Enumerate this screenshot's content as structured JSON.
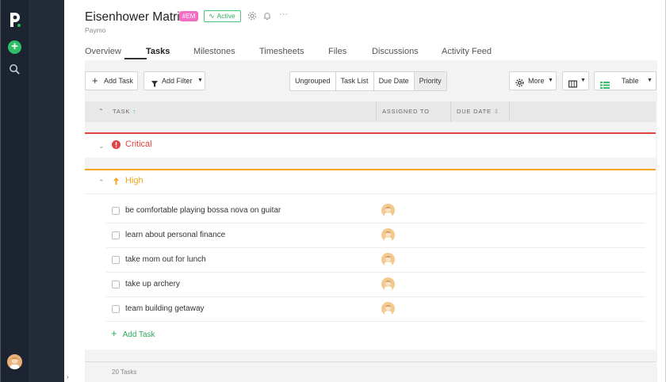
{
  "sidebar": {
    "logo": "p-logo",
    "add_icon": "plus-icon",
    "search_icon": "search-icon",
    "nav_icons": [
      "home-icon",
      "projects-icon",
      "folder-icon",
      "user-icon",
      "money-icon",
      "ledger-icon",
      "table-icon",
      "refresh-icon",
      "calendar-icon",
      "clock-icon",
      "pie-chart-icon",
      "report-icon"
    ],
    "help_icon": "info-icon"
  },
  "project": {
    "title": "Eisenhower Matrix",
    "code_tag": "#EM",
    "status": "Active",
    "client": "Paymo"
  },
  "tabs": [
    {
      "label": "Overview"
    },
    {
      "label": "Tasks"
    },
    {
      "label": "Milestones"
    },
    {
      "label": "Timesheets"
    },
    {
      "label": "Files"
    },
    {
      "label": "Discussions"
    },
    {
      "label": "Activity Feed"
    }
  ],
  "toolbar": {
    "add_task": "Add Task",
    "add_filter": "Add Filter",
    "views": [
      "Ungrouped",
      "Task List",
      "Due Date",
      "Priority"
    ],
    "more": "More",
    "layout": "Table"
  },
  "columns": {
    "task": "TASK",
    "assigned_to": "ASSIGNED TO",
    "due_date": "DUE DATE"
  },
  "groups": {
    "critical": {
      "title": "Critical",
      "color": "#e24343"
    },
    "high": {
      "title": "High",
      "color": "#f2a623"
    }
  },
  "tasks": [
    {
      "name": "be comfortable playing bossa nova on guitar"
    },
    {
      "name": "learn about personal finance"
    },
    {
      "name": "take mom out for lunch"
    },
    {
      "name": "take up archery"
    },
    {
      "name": "team building getaway"
    }
  ],
  "add_task_inline": "Add Task",
  "footer": {
    "count": "20 Tasks"
  }
}
